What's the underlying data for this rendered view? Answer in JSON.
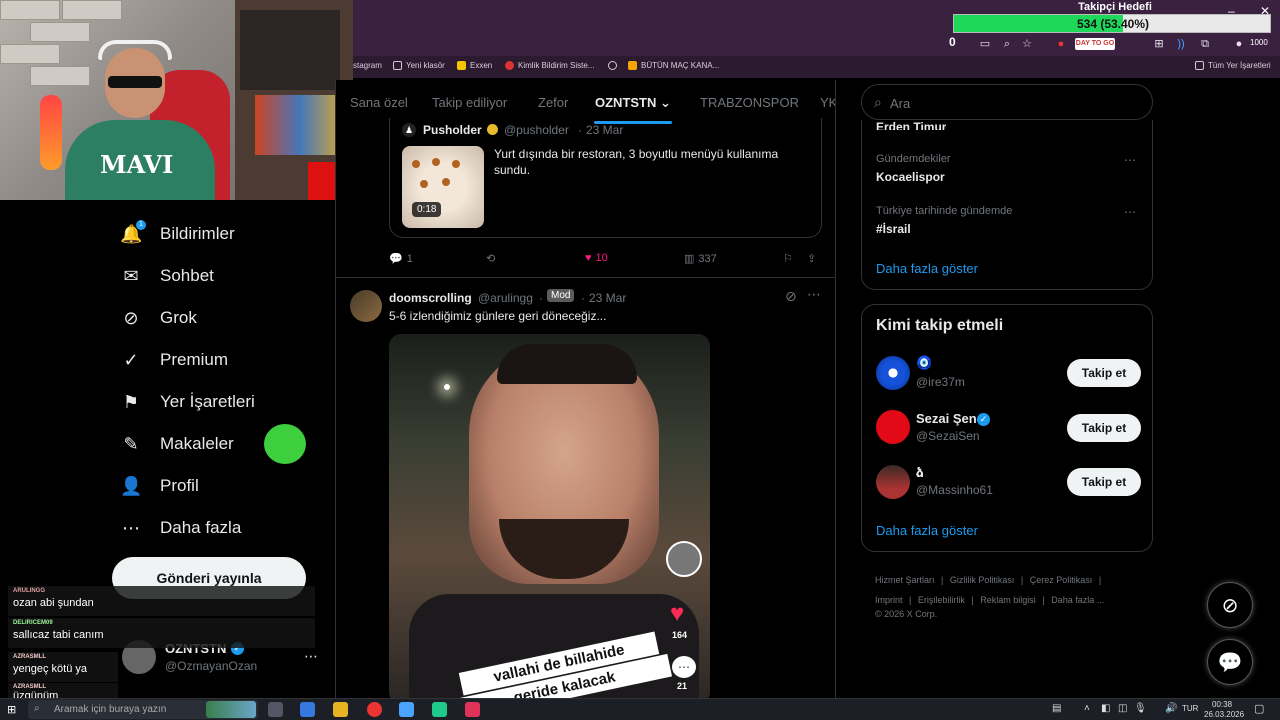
{
  "browser": {
    "bookmarks": [
      "stagram",
      "Yeni klasör",
      "Exxen",
      "Kimlik Bildirim Siste...",
      "BÜTÜN MAÇ KANA...",
      "Tüm Yer İşaretleri"
    ],
    "extension_badge": "0",
    "ext_text": "DAY TO GO",
    "profile_count": "1000"
  },
  "goal": {
    "label": "Takipçi Hedefi",
    "text": "534 (53.40%)",
    "progress": 0.534,
    "color": "#1ed85a"
  },
  "nav": {
    "items": [
      {
        "label": "Bildirimler",
        "icon": "bell-icon",
        "glyph": "🔔"
      },
      {
        "label": "Sohbet",
        "icon": "mail-icon",
        "glyph": "✉"
      },
      {
        "label": "Grok",
        "icon": "grok-icon",
        "glyph": "⊘"
      },
      {
        "label": "Premium",
        "icon": "verified-icon",
        "glyph": "✓"
      },
      {
        "label": "Yer İşaretleri",
        "icon": "bookmark-icon",
        "glyph": "🔖"
      },
      {
        "label": "Makaleler",
        "icon": "article-icon",
        "glyph": "✎"
      },
      {
        "label": "Profil",
        "icon": "person-icon",
        "glyph": "👤"
      },
      {
        "label": "Daha fazla",
        "icon": "more-icon",
        "glyph": "⋯"
      }
    ],
    "notification_count": "1",
    "post_button": "Gönderi yayınla",
    "profile_name": "OZNTSTN",
    "profile_handle": "@OzmayanOzan"
  },
  "tabs": [
    "Sana özel",
    "Takip ediliyor",
    "Zefor",
    "OZNTSTN",
    "TRABZONSPOR",
    "YK"
  ],
  "quote_tweet": {
    "author": "Pusholder",
    "handle": "@pusholder",
    "date": "23 Mar",
    "text": "Yurt dışında bir restoran, 3 boyutlu menüyü kullanıma sundu.",
    "video_duration": "0:18"
  },
  "tweet1_actions": {
    "replies": "1",
    "retweets": "",
    "likes": "10",
    "views": "337"
  },
  "tweet2": {
    "author": "doomscrolling",
    "handle": "@arulingg",
    "badge": "Mod",
    "date": "23 Mar",
    "text": "5-6 izlendiğimiz günlere geri döneceğiz...",
    "video_likes": "164",
    "video_comments": "21",
    "caption_line1": "vallahi de billahide",
    "caption_line2": "geride kalacak"
  },
  "right": {
    "search_placeholder": "Ara",
    "trend_cut": "Erden Timur",
    "trends": [
      {
        "context": "Gündemdekiler",
        "name": "Kocaelispor"
      },
      {
        "context": "Türkiye tarihinde gündemde",
        "name": "#İsrail"
      }
    ],
    "show_more": "Daha fazla göster",
    "follow_title": "Kimi takip etmeli",
    "who_to_follow": [
      {
        "name": "🧿",
        "handle": "@ire37m",
        "button": "Takip et"
      },
      {
        "name": "Sezai Şen",
        "handle": "@SezaiSen",
        "button": "Takip et"
      },
      {
        "name": "ձ",
        "handle": "@Massinho61",
        "button": "Takip et"
      }
    ],
    "footer": [
      "Hizmet Şartları",
      "Gizlilik Politikası",
      "Çerez Politikası",
      "Imprint",
      "Erişilebilirlik",
      "Reklam bilgisi",
      "Daha fazla ...",
      "© 2026 X Corp."
    ]
  },
  "chat": [
    {
      "user": "ARULINGG",
      "text": "ozan abi şundan",
      "user_color": "#e0a0a0"
    },
    {
      "user": "DELIRICEM09",
      "text": "sallıcaz tabi canım",
      "user_color": "#9cf59c"
    },
    {
      "user": "AZRASMLL",
      "text": "yengeç kötü ya",
      "user_color": "#f0c8c8"
    },
    {
      "user": "AZRASMLL",
      "text": "üzgünüm",
      "user_color": "#f0c8c8"
    }
  ],
  "taskbar": {
    "search_placeholder": "Aramak için buraya yazın",
    "lang": "TUR",
    "time": "00:38",
    "date": "26.03.2026"
  }
}
